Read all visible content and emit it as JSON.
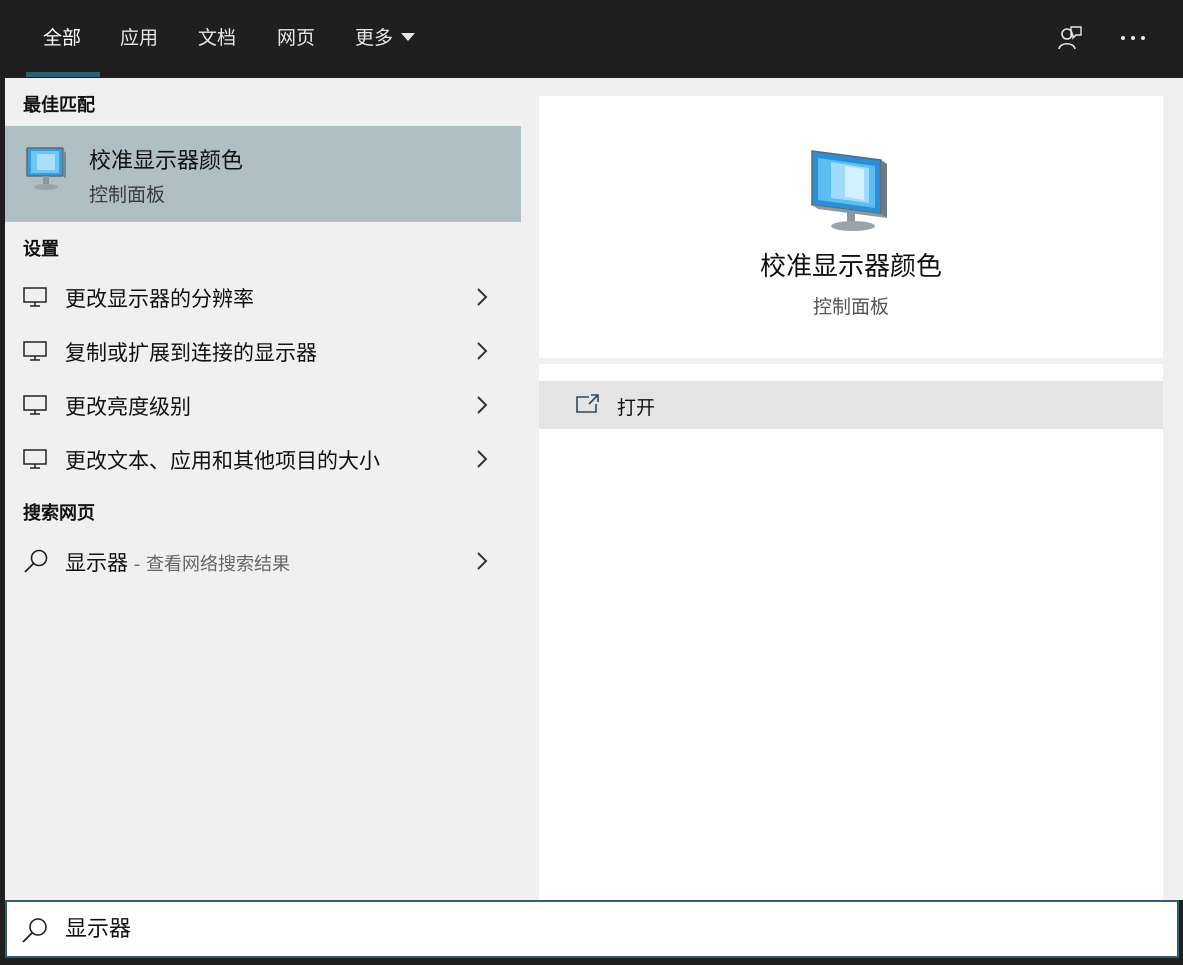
{
  "tabs": [
    {
      "label": "全部",
      "active": true
    },
    {
      "label": "应用",
      "active": false
    },
    {
      "label": "文档",
      "active": false
    },
    {
      "label": "网页",
      "active": false
    },
    {
      "label": "更多",
      "active": false
    }
  ],
  "topbar_icons": [
    "feedback-icon",
    "more-options-icon"
  ],
  "best_match": {
    "header": "最佳匹配",
    "title": "校准显示器颜色",
    "subtitle": "控制面板",
    "icon": "monitor-color-icon"
  },
  "settings": {
    "header": "设置",
    "items": [
      {
        "label": "更改显示器的分辨率",
        "icon": "display-icon"
      },
      {
        "label": "复制或扩展到连接的显示器",
        "icon": "display-icon"
      },
      {
        "label": "更改亮度级别",
        "icon": "display-icon"
      },
      {
        "label": "更改文本、应用和其他项目的大小",
        "icon": "display-icon"
      }
    ]
  },
  "web_search": {
    "header": "搜索网页",
    "query": "显示器",
    "hint": " - 查看网络搜索结果",
    "icon": "search-icon"
  },
  "preview": {
    "title": "校准显示器颜色",
    "subtitle": "控制面板"
  },
  "actions": [
    {
      "label": "打开",
      "icon": "open-external-icon"
    }
  ],
  "search": {
    "value": "显示器"
  },
  "colors": {
    "topbar": "#1f1f1f",
    "accent": "#2f5f73",
    "selected_row": "#b0bfc4",
    "pane_bg": "#f0f0f0"
  }
}
